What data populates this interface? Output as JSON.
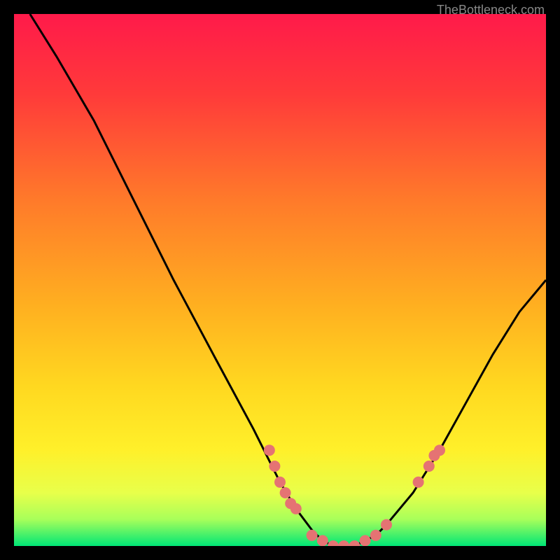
{
  "watermark": "TheBottleneck.com",
  "chart_data": {
    "type": "line",
    "title": "",
    "xlabel": "",
    "ylabel": "",
    "xlim": [
      0,
      100
    ],
    "ylim": [
      0,
      100
    ],
    "gradient_colors": {
      "top": "#ff1744",
      "upper_mid": "#ff5722",
      "mid": "#ffc107",
      "lower_mid": "#ffeb3b",
      "lower": "#cddc39",
      "bottom": "#00e676"
    },
    "series": [
      {
        "name": "bottleneck-curve",
        "color": "#000000",
        "x": [
          3,
          8,
          15,
          22,
          30,
          38,
          45,
          50,
          53,
          56,
          58,
          60,
          62,
          64,
          66,
          68,
          70,
          75,
          80,
          85,
          90,
          95,
          100
        ],
        "y": [
          100,
          92,
          80,
          66,
          50,
          35,
          22,
          12,
          7,
          3,
          1,
          0,
          0,
          0,
          1,
          2,
          4,
          10,
          18,
          27,
          36,
          44,
          50
        ]
      }
    ],
    "points": {
      "name": "data-points",
      "color": "#e57373",
      "radius": 8,
      "data": [
        {
          "x": 48,
          "y": 18
        },
        {
          "x": 49,
          "y": 15
        },
        {
          "x": 50,
          "y": 12
        },
        {
          "x": 51,
          "y": 10
        },
        {
          "x": 52,
          "y": 8
        },
        {
          "x": 53,
          "y": 7
        },
        {
          "x": 56,
          "y": 2
        },
        {
          "x": 58,
          "y": 1
        },
        {
          "x": 60,
          "y": 0
        },
        {
          "x": 62,
          "y": 0
        },
        {
          "x": 64,
          "y": 0
        },
        {
          "x": 66,
          "y": 1
        },
        {
          "x": 68,
          "y": 2
        },
        {
          "x": 70,
          "y": 4
        },
        {
          "x": 76,
          "y": 12
        },
        {
          "x": 78,
          "y": 15
        },
        {
          "x": 79,
          "y": 17
        },
        {
          "x": 80,
          "y": 18
        }
      ]
    }
  }
}
